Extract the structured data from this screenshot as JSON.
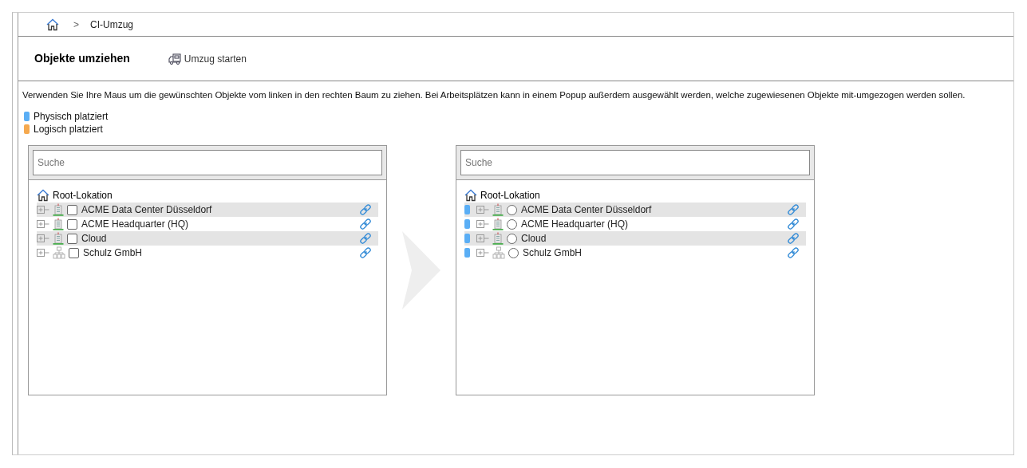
{
  "breadcrumb": {
    "separator": ">",
    "current": "CI-Umzug"
  },
  "header": {
    "title": "Objekte umziehen",
    "action": "Umzug starten"
  },
  "instructions": "Verwenden Sie Ihre Maus um die gewünschten Objekte vom linken in den rechten Baum zu ziehen. Bei Arbeitsplätzen kann in einem Popup außerdem ausgewählt werden, welche zugewiesenen Objekte mit-umgezogen werden sollen.",
  "legend": [
    {
      "label": "Physisch platziert",
      "color": "#5aaef5"
    },
    {
      "label": "Logisch platziert",
      "color": "#f5a94f"
    }
  ],
  "source_tree": {
    "search": {
      "placeholder": "Suche"
    },
    "root": "Root-Lokation",
    "items": [
      {
        "label": "ACME Data Center Düsseldorf",
        "kind": "building",
        "checked": false
      },
      {
        "label": "ACME Headquarter (HQ)",
        "kind": "building",
        "checked": false
      },
      {
        "label": "Cloud",
        "kind": "building",
        "checked": false
      },
      {
        "label": "Schulz GmbH",
        "kind": "organization",
        "checked": false
      }
    ]
  },
  "target_tree": {
    "search": {
      "placeholder": "Suche"
    },
    "root": "Root-Lokation",
    "items": [
      {
        "label": "ACME Data Center Düsseldorf",
        "kind": "building",
        "selected": false,
        "color": "#5aaef5"
      },
      {
        "label": "ACME Headquarter (HQ)",
        "kind": "building",
        "selected": false,
        "color": "#5aaef5"
      },
      {
        "label": "Cloud",
        "kind": "building",
        "selected": false,
        "color": "#5aaef5"
      },
      {
        "label": "Schulz GmbH",
        "kind": "organization",
        "selected": false,
        "color": "#5aaef5"
      }
    ]
  }
}
